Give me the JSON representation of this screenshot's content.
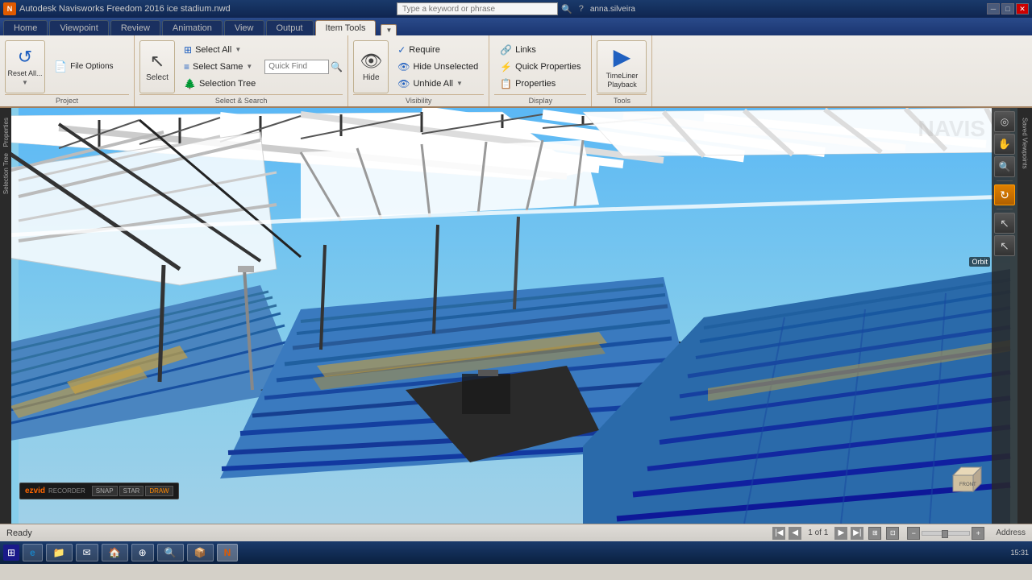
{
  "app": {
    "title": "Autodesk Navisworks Freedom 2016",
    "file": "ice stadium.nwd",
    "title_full": "Autodesk Navisworks Freedom 2016  ice stadium.nwd"
  },
  "titlebar": {
    "minimize": "─",
    "restore": "□",
    "close": "✕",
    "app_icon": "N"
  },
  "search": {
    "placeholder": "Type a keyword or phrase"
  },
  "user": {
    "name": "anna.silveira"
  },
  "tabs": [
    {
      "id": "home",
      "label": "Home"
    },
    {
      "id": "viewpoint",
      "label": "Viewpoint"
    },
    {
      "id": "review",
      "label": "Review"
    },
    {
      "id": "animation",
      "label": "Animation"
    },
    {
      "id": "view",
      "label": "View"
    },
    {
      "id": "output",
      "label": "Output"
    },
    {
      "id": "item-tools",
      "label": "Item Tools",
      "active": true
    }
  ],
  "ribbon": {
    "groups": [
      {
        "id": "project",
        "label": "Project",
        "buttons": [
          {
            "id": "reset-all",
            "label": "Reset All...",
            "icon": "↺",
            "size": "large",
            "has_dropdown": true
          },
          {
            "id": "file-options",
            "label": "File Options",
            "icon": "📄",
            "size": "small"
          }
        ]
      },
      {
        "id": "select",
        "label": "Select",
        "buttons": [
          {
            "id": "select",
            "label": "Select",
            "icon": "↖",
            "size": "large"
          },
          {
            "id": "select-all",
            "label": "Select All",
            "icon": "⊞",
            "size": "small",
            "has_dropdown": true
          },
          {
            "id": "select-same",
            "label": "Select Same",
            "icon": "≡",
            "size": "small",
            "has_dropdown": true
          },
          {
            "id": "selection-tree",
            "label": "Selection Tree",
            "icon": "🌲",
            "size": "small"
          },
          {
            "id": "quick-find",
            "label": "Quick Find",
            "placeholder": "Quick Find",
            "type": "input"
          }
        ]
      },
      {
        "id": "select-search",
        "label": "Select & Search"
      },
      {
        "id": "visibility",
        "label": "Visibility",
        "buttons": [
          {
            "id": "hide",
            "label": "Hide",
            "icon": "👁",
            "size": "large"
          },
          {
            "id": "require",
            "label": "Require",
            "icon": "✓",
            "size": "small"
          },
          {
            "id": "hide-unselected",
            "label": "Hide Unselected",
            "icon": "👁",
            "size": "small"
          },
          {
            "id": "unhide-all",
            "label": "Unhide All",
            "icon": "👁",
            "size": "small",
            "has_dropdown": true
          }
        ]
      },
      {
        "id": "display",
        "label": "Display",
        "buttons": [
          {
            "id": "links",
            "label": "Links",
            "icon": "🔗",
            "size": "small"
          },
          {
            "id": "quick-properties",
            "label": "Quick Properties",
            "icon": "⚡",
            "size": "small"
          },
          {
            "id": "properties",
            "label": "Properties",
            "icon": "📋",
            "size": "small"
          }
        ]
      },
      {
        "id": "tools",
        "label": "Tools",
        "buttons": [
          {
            "id": "timeliner-playback",
            "label": "TimeLiner Playback",
            "icon": "▶",
            "size": "large"
          }
        ]
      }
    ]
  },
  "viewport": {
    "watermark": "NAVIS",
    "orbit_label": "Orbit"
  },
  "right_toolbar": {
    "buttons": [
      {
        "id": "look",
        "icon": "◎",
        "label": "look"
      },
      {
        "id": "pan",
        "icon": "✋",
        "label": "pan"
      },
      {
        "id": "zoom",
        "icon": "🔍",
        "label": "zoom"
      },
      {
        "id": "orbit",
        "icon": "↻",
        "label": "Orbit",
        "active": true
      },
      {
        "id": "select-tool",
        "icon": "↖",
        "label": "select"
      }
    ]
  },
  "status_bar": {
    "status": "Ready",
    "page_info": "1 of 1",
    "address_label": "Address"
  },
  "ezvid": {
    "logo": "ezvid",
    "sub": "RECORDER",
    "btn1": "SNAP",
    "btn2": "STAR",
    "btn3": "DRAW"
  },
  "taskbar": {
    "time": "15:31",
    "items": [
      {
        "id": "windows",
        "icon": "⊞"
      },
      {
        "id": "ie",
        "icon": "e"
      },
      {
        "id": "explorer",
        "icon": "📁"
      },
      {
        "id": "outlook",
        "icon": "✉"
      },
      {
        "id": "navisworks-nav",
        "icon": "🏠"
      },
      {
        "id": "chrome",
        "icon": "⊕"
      },
      {
        "id": "search",
        "icon": "🔍"
      },
      {
        "id": "nav2",
        "icon": "N",
        "active": true
      },
      {
        "id": "misc",
        "icon": "📦"
      }
    ]
  },
  "left_panel": {
    "labels": [
      "Selection Tree",
      "Properties"
    ]
  },
  "right_panel": {
    "labels": [
      "Saved Viewpoints"
    ]
  }
}
